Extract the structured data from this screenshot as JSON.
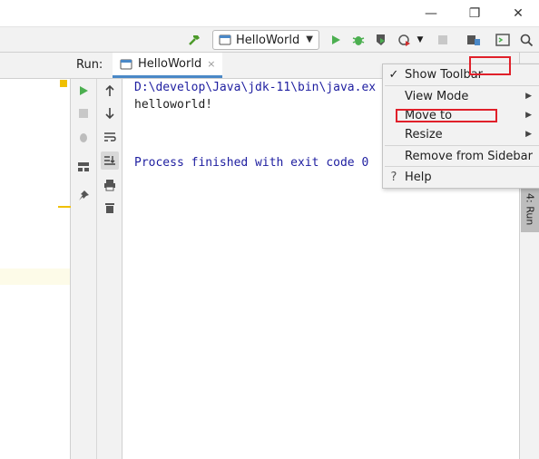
{
  "window_controls": {
    "minimize": "—",
    "maximize": "❐",
    "close": "✕"
  },
  "toolbar": {
    "run_config": "HelloWorld",
    "icons": [
      "hammer-icon",
      "run-icon",
      "debug-icon",
      "coverage-icon",
      "profile-icon",
      "stop-icon",
      "project-structure-icon",
      "terminal-icon",
      "search-icon"
    ]
  },
  "run_panel": {
    "label": "Run:",
    "tab_label": "HelloWorld",
    "tab_close": "×"
  },
  "console": {
    "line1": "D:\\develop\\Java\\jdk-11\\bin\\java.ex",
    "line2": "helloworld!",
    "line3": "Process finished with exit code 0"
  },
  "right_strip": {
    "run_tab": "4: Run"
  },
  "context_menu": {
    "show_toolbar": "Show Toolbar",
    "show_toolbar_check": "✓",
    "view_mode": "View Mode",
    "move_to": "Move to",
    "resize": "Resize",
    "remove_from_sidebar": "Remove from Sidebar",
    "help": "Help",
    "help_icon": "?",
    "submenu_arrow": "▶"
  },
  "colors": {
    "accent": "#4a88c7",
    "run_green": "#4caf50",
    "highlight_red": "#e0202a",
    "console_blue": "#1e1ea0"
  }
}
